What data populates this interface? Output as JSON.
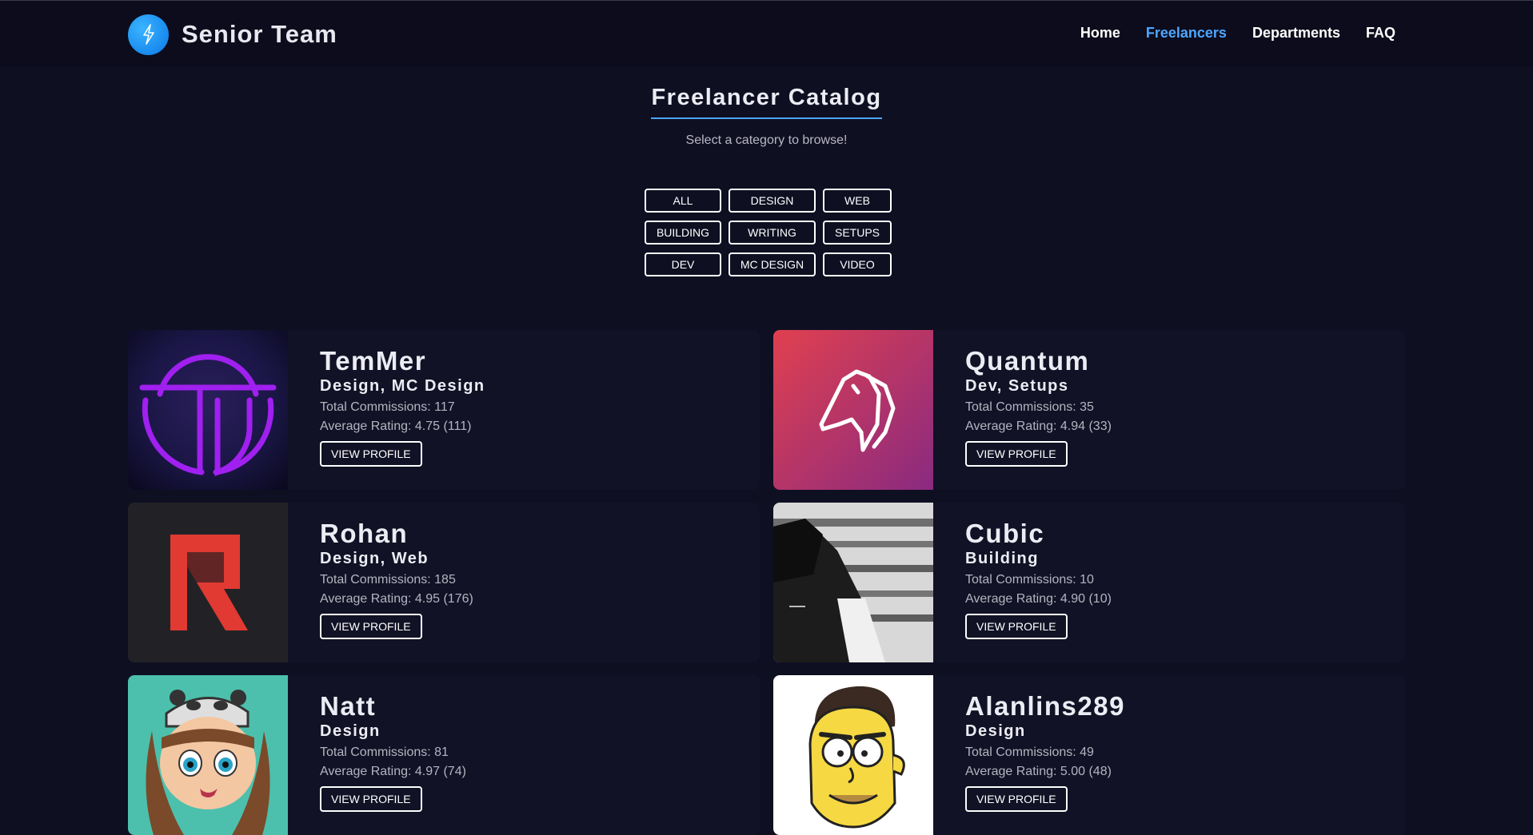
{
  "header": {
    "brand": "Senior Team",
    "nav": [
      "Home",
      "Freelancers",
      "Departments",
      "FAQ"
    ],
    "active_nav": "Freelancers"
  },
  "catalog": {
    "title": "Freelancer Catalog",
    "subtitle": "Select a category to browse!",
    "filters": [
      "ALL",
      "DESIGN",
      "WEB",
      "BUILDING",
      "WRITING",
      "SETUPS",
      "DEV",
      "MC DESIGN",
      "VIDEO"
    ]
  },
  "view_label": "VIEW PROFILE",
  "freelancers": [
    {
      "name": "TemMer",
      "categories": "Design, MC Design",
      "commissions": "Total Commissions: 117",
      "rating": "Average Rating: 4.75 (111)"
    },
    {
      "name": "Quantum",
      "categories": "Dev, Setups",
      "commissions": "Total Commissions: 35",
      "rating": "Average Rating: 4.94 (33)"
    },
    {
      "name": "Rohan",
      "categories": "Design, Web",
      "commissions": "Total Commissions: 185",
      "rating": "Average Rating: 4.95 (176)"
    },
    {
      "name": "Cubic",
      "categories": "Building",
      "commissions": "Total Commissions: 10",
      "rating": "Average Rating: 4.90 (10)"
    },
    {
      "name": "Natt",
      "categories": "Design",
      "commissions": "Total Commissions: 81",
      "rating": "Average Rating: 4.97 (74)"
    },
    {
      "name": "Alanlins289",
      "categories": "Design",
      "commissions": "Total Commissions: 49",
      "rating": "Average Rating: 5.00 (48)"
    }
  ],
  "colors": {
    "background": "#0f0f22",
    "header": "#0c0c1c",
    "card": "#121226",
    "accent": "#4ea6ff"
  }
}
